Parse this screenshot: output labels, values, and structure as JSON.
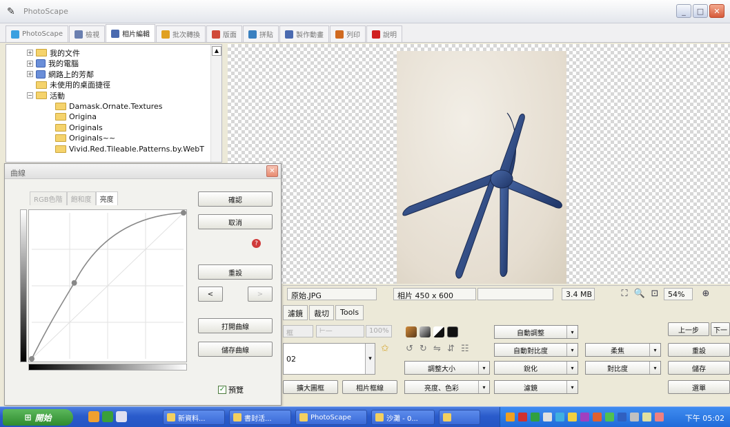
{
  "window": {
    "title": "PhotoScape"
  },
  "tabs": [
    {
      "label": "PhotoScape",
      "color": "#3aa0e0",
      "active": false
    },
    {
      "label": "檢視",
      "color": "#6a7fb0",
      "active": false
    },
    {
      "label": "相片編輯",
      "color": "#4a6ab0",
      "active": true
    },
    {
      "label": "批次轉換",
      "color": "#e0a020",
      "active": false
    },
    {
      "label": "版面",
      "color": "#d04a3a",
      "active": false
    },
    {
      "label": "拼貼",
      "color": "#3a80c0",
      "active": false
    },
    {
      "label": "製作動畫",
      "color": "#4a6ab0",
      "active": false
    },
    {
      "label": "列印",
      "color": "#d06a20",
      "active": false
    },
    {
      "label": "說明",
      "color": "#d02020",
      "active": false
    }
  ],
  "tree": {
    "items": [
      {
        "label": "我的文件",
        "icon": "folder",
        "indent": 0,
        "expander": "+"
      },
      {
        "label": "我的電腦",
        "icon": "drive",
        "indent": 0,
        "expander": "+"
      },
      {
        "label": "網路上的芳鄰",
        "icon": "drive",
        "indent": 0,
        "expander": "+"
      },
      {
        "label": "未使用的桌面捷徑",
        "icon": "folder",
        "indent": 0,
        "expander": ""
      },
      {
        "label": "活動",
        "icon": "folder",
        "indent": 0,
        "expander": "−"
      },
      {
        "label": "Damask.Ornate.Textures",
        "icon": "folder",
        "indent": 1,
        "expander": ""
      },
      {
        "label": "Origina",
        "icon": "folder",
        "indent": 1,
        "expander": ""
      },
      {
        "label": "Originals",
        "icon": "folder",
        "indent": 1,
        "expander": ""
      },
      {
        "label": "Originals~~",
        "icon": "folder",
        "indent": 1,
        "expander": ""
      },
      {
        "label": "Vivid.Red.Tileable.Patterns.by.WebT",
        "icon": "folder",
        "indent": 1,
        "expander": ""
      }
    ]
  },
  "dialog": {
    "title": "曲線",
    "tabs": [
      {
        "label": "RGB色階",
        "active": false
      },
      {
        "label": "飽和度",
        "active": false
      },
      {
        "label": "亮度",
        "active": true
      }
    ],
    "buttons": {
      "ok": "確認",
      "cancel": "取消",
      "reset": "重設",
      "prev": "<",
      "next": ">",
      "open_curve": "打開曲線",
      "save_curve": "儲存曲線"
    },
    "preview_label": "預覽",
    "curve_points": [
      {
        "in": 0,
        "out": 0
      },
      {
        "in": 0.28,
        "out": 0.52
      },
      {
        "in": 1,
        "out": 1
      }
    ]
  },
  "status": {
    "filename": "原始.JPG",
    "dims": "相片 450 x 600",
    "size": "3.4 MB",
    "zoom": "54%"
  },
  "lower_tabs": [
    "濾鏡",
    "裁切",
    "Tools"
  ],
  "lower": {
    "slider_label": "框",
    "percent": "100%",
    "combo_value": "02",
    "btn_enlarge": "擴大圖框",
    "btn_photo_edge": "相片框線",
    "dd_resize": "調整大小",
    "dd_bright": "亮度、色彩",
    "dd_auto_level": "自動調整",
    "dd_auto_contrast": "自動對比度",
    "dd_sharpen": "銳化",
    "dd_filter": "濾鏡",
    "dd_soften": "柔焦",
    "dd_contrast2": "對比度",
    "btn_undo": "上一步",
    "btn_next": "下一",
    "btn_reset": "重設",
    "btn_save": "儲存",
    "btn_menu": "選單"
  },
  "taskbar": {
    "start": "開始",
    "tasks": [
      "新資料...",
      "書封活...",
      "PhotoScape",
      "沙灘 - 0...",
      ""
    ],
    "clock": "下午 05:02"
  }
}
